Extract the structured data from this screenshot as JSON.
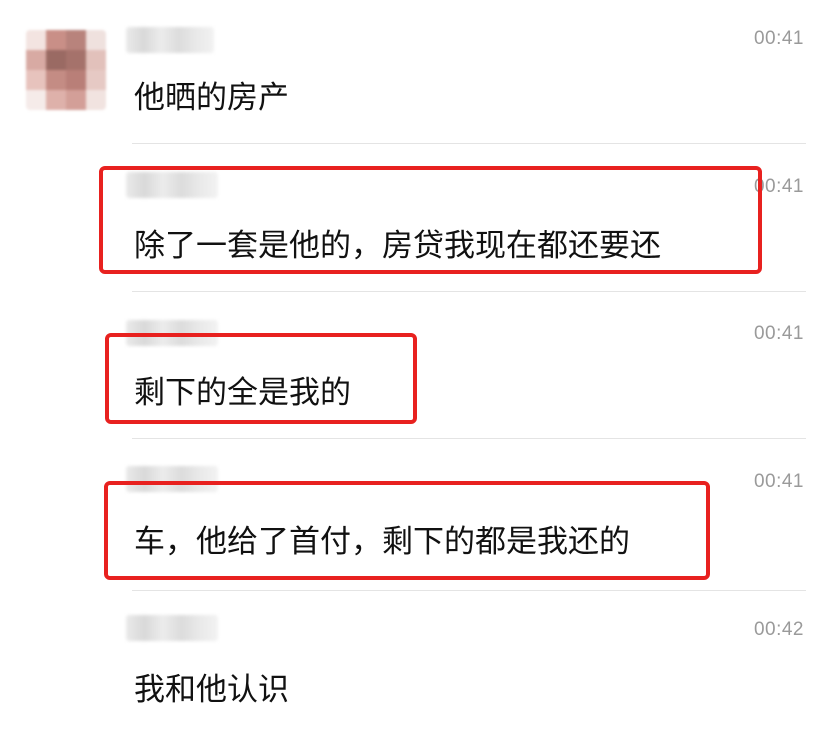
{
  "messages": [
    {
      "time": "00:41",
      "text": "他晒的房产",
      "highlighted": false
    },
    {
      "time": "00:41",
      "text": "除了一套是他的，房贷我现在都还要还",
      "highlighted": true
    },
    {
      "time": "00:41",
      "text": "剩下的全是我的",
      "highlighted": true
    },
    {
      "time": "00:41",
      "text": "车，他给了首付，剩下的都是我还的",
      "highlighted": true
    },
    {
      "time": "00:42",
      "text": "我和他认识",
      "highlighted": false
    }
  ],
  "colors": {
    "highlight_border": "#e8211f",
    "timestamp": "#9a9a9a",
    "divider": "#e4e4e4"
  },
  "icons": {
    "avatar": "blurred-avatar"
  }
}
